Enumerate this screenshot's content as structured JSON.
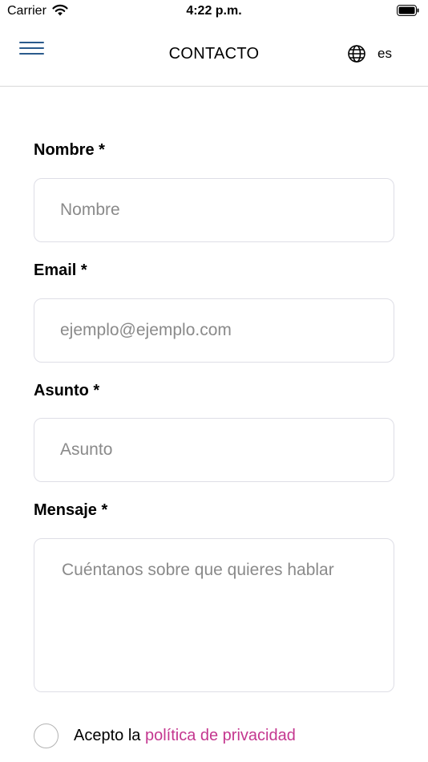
{
  "status_bar": {
    "carrier": "Carrier",
    "time": "4:22 p.m."
  },
  "nav": {
    "title": "CONTACTO",
    "language": "es"
  },
  "form": {
    "name_label": "Nombre *",
    "name_placeholder": "Nombre",
    "email_label": "Email *",
    "email_placeholder": "ejemplo@ejemplo.com",
    "subject_label": "Asunto *",
    "subject_placeholder": "Asunto",
    "message_label": "Mensaje *",
    "message_placeholder": "Cuéntanos sobre que quieres hablar"
  },
  "consent": {
    "prefix": "Acepto la ",
    "link": "política de privacidad",
    "link_color": "#c4378f",
    "checked": false
  },
  "icons": {
    "menu": "hamburger-icon",
    "language": "globe-icon",
    "wifi": "wifi-icon",
    "battery": "battery-icon"
  }
}
